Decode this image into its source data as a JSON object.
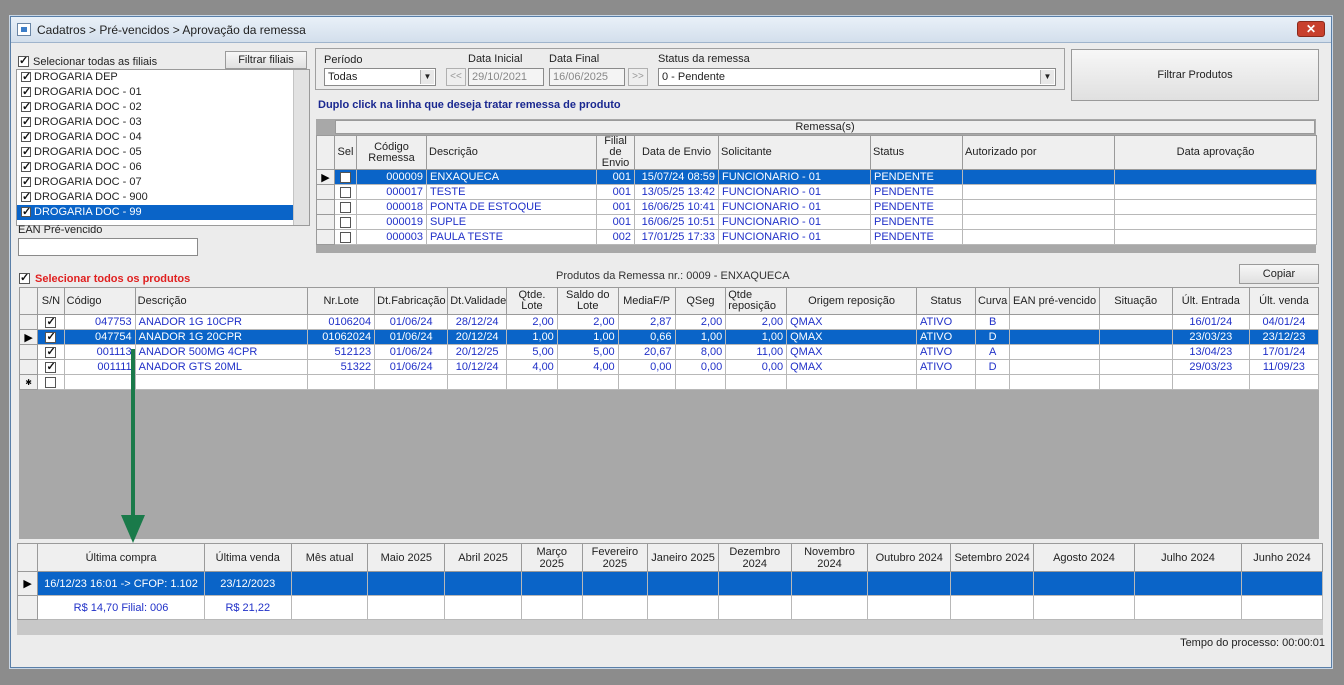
{
  "window": {
    "title": "Cadatros > Pré-vencidos > Aprovação da remessa",
    "close": "✕"
  },
  "filiais": {
    "select_all_label": "Selecionar todas as filiais",
    "filter_button": "Filtrar filiais",
    "items": [
      {
        "label": "DROGARIA DEP",
        "checked": true
      },
      {
        "label": "DROGARIA DOC - 01",
        "checked": true
      },
      {
        "label": "DROGARIA DOC - 02",
        "checked": true
      },
      {
        "label": "DROGARIA DOC - 03",
        "checked": true
      },
      {
        "label": "DROGARIA DOC - 04",
        "checked": true
      },
      {
        "label": "DROGARIA DOC - 05",
        "checked": true
      },
      {
        "label": "DROGARIA DOC - 06",
        "checked": true
      },
      {
        "label": "DROGARIA DOC - 07",
        "checked": true
      },
      {
        "label": "DROGARIA DOC - 900",
        "checked": true
      },
      {
        "label": "DROGARIA DOC - 99",
        "checked": true,
        "selected": true
      }
    ],
    "ean_label": "EAN Pré-vencido",
    "ean_value": ""
  },
  "filters": {
    "periodo_label": "Período",
    "periodo_value": "Todas",
    "data_inicial_label": "Data Inicial",
    "data_inicial_value": "29/10/2021",
    "data_final_label": "Data Final",
    "data_final_value": "16/06/2025",
    "prev_btn": "<<",
    "next_btn": ">>",
    "status_label": "Status da remessa",
    "status_value": "0 - Pendente",
    "filter_products_button": "Filtrar Produtos"
  },
  "hint": "Duplo click na linha que deseja tratar remessa de produto",
  "remessas": {
    "group_title": "Remessa(s)",
    "columns": [
      "Sel",
      "Código Remessa",
      "Descrição",
      "Filial de Envio",
      "Data de Envio",
      "Solicitante",
      "Status",
      "Autorizado por",
      "Data aprovação"
    ],
    "rows": [
      {
        "codigo": "000009",
        "descricao": "ENXAQUECA",
        "filial": "001",
        "data": "15/07/24 08:59",
        "solicitante": "FUNCIONARIO - 01",
        "status": "PENDENTE",
        "autorizado": "",
        "aprovacao": "",
        "selected": true
      },
      {
        "codigo": "000017",
        "descricao": "TESTE",
        "filial": "001",
        "data": "13/05/25 13:42",
        "solicitante": "FUNCIONARIO - 01",
        "status": "PENDENTE",
        "autorizado": "",
        "aprovacao": ""
      },
      {
        "codigo": "000018",
        "descricao": "PONTA DE ESTOQUE",
        "filial": "001",
        "data": "16/06/25 10:41",
        "solicitante": "FUNCIONARIO - 01",
        "status": "PENDENTE",
        "autorizado": "",
        "aprovacao": ""
      },
      {
        "codigo": "000019",
        "descricao": "SUPLE",
        "filial": "001",
        "data": "16/06/25 10:51",
        "solicitante": "FUNCIONARIO - 01",
        "status": "PENDENTE",
        "autorizado": "",
        "aprovacao": ""
      },
      {
        "codigo": "000003",
        "descricao": "PAULA TESTE",
        "filial": "002",
        "data": "17/01/25 17:33",
        "solicitante": "FUNCIONARIO - 01",
        "status": "PENDENTE",
        "autorizado": "",
        "aprovacao": ""
      }
    ]
  },
  "produtos": {
    "select_all_label": "Selecionar todos os produtos",
    "group_title": "Produtos da Remessa nr.: 0009 - ENXAQUECA",
    "copy_button": "Copiar",
    "columns": [
      "S/N",
      "Código",
      "Descrição",
      "Nr.Lote",
      "Dt.Fabricação",
      "Dt.Validade",
      "Qtde. Lote",
      "Saldo do Lote",
      "MediaF/P",
      "QSeg",
      "Qtde reposição",
      "Origem reposição",
      "Status",
      "Curva",
      "EAN pré-vencido",
      "Situação",
      "Últ. Entrada",
      "Últ. venda"
    ],
    "rows": [
      {
        "sn": true,
        "codigo": "047753",
        "descricao": "ANADOR 1G 10CPR",
        "lote": "0106204",
        "fab": "01/06/24",
        "val": "28/12/24",
        "qtde": "2,00",
        "saldo": "2,00",
        "media": "2,87",
        "qseg": "2,00",
        "rep": "2,00",
        "origem": "QMAX",
        "status": "ATIVO",
        "curva": "B",
        "ean": "",
        "situacao": "",
        "entrada": "16/01/24",
        "venda": "04/01/24"
      },
      {
        "sn": true,
        "codigo": "047754",
        "descricao": "ANADOR 1G 20CPR",
        "lote": "01062024",
        "fab": "01/06/24",
        "val": "20/12/24",
        "qtde": "1,00",
        "saldo": "1,00",
        "media": "0,66",
        "qseg": "1,00",
        "rep": "1,00",
        "origem": "QMAX",
        "status": "ATIVO",
        "curva": "D",
        "ean": "",
        "situacao": "",
        "entrada": "23/03/23",
        "venda": "23/12/23",
        "selected": true
      },
      {
        "sn": true,
        "codigo": "001113",
        "descricao": "ANADOR 500MG 4CPR",
        "lote": "512123",
        "fab": "01/06/24",
        "val": "20/12/25",
        "qtde": "5,00",
        "saldo": "5,00",
        "media": "20,67",
        "qseg": "8,00",
        "rep": "11,00",
        "origem": "QMAX",
        "status": "ATIVO",
        "curva": "A",
        "ean": "",
        "situacao": "",
        "entrada": "13/04/23",
        "venda": "17/01/24"
      },
      {
        "sn": true,
        "codigo": "001111",
        "descricao": "ANADOR GTS 20ML",
        "lote": "51322",
        "fab": "01/06/24",
        "val": "10/12/24",
        "qtde": "4,00",
        "saldo": "4,00",
        "media": "0,00",
        "qseg": "0,00",
        "rep": "0,00",
        "origem": "QMAX",
        "status": "ATIVO",
        "curva": "D",
        "ean": "",
        "situacao": "",
        "entrada": "29/03/23",
        "venda": "11/09/23"
      }
    ]
  },
  "vendas": {
    "columns": [
      "Última compra",
      "Última venda",
      "Mês atual",
      "Maio 2025",
      "Abril 2025",
      "Março 2025",
      "Fevereiro 2025",
      "Janeiro 2025",
      "Dezembro 2024",
      "Novembro 2024",
      "Outubro 2024",
      "Setembro 2024",
      "Agosto 2024",
      "Julho 2024",
      "Junho 2024"
    ],
    "rows": [
      [
        "16/12/23 16:01 -> CFOP: 1.102",
        "23/12/2023",
        "",
        "",
        "",
        "",
        "",
        "",
        "",
        "",
        "",
        "",
        "",
        "",
        ""
      ],
      [
        "R$ 14,70 Filial: 006",
        "R$ 21,22",
        "",
        "",
        "",
        "",
        "",
        "",
        "",
        "",
        "",
        "",
        "",
        "",
        ""
      ]
    ]
  },
  "status_bar": "Tempo do processo: 00:00:01",
  "colors": {
    "selection": "#0a64c8",
    "arrow": "#1a7a4a",
    "data_text": "#2030c8",
    "alert_text": "#e02020"
  }
}
